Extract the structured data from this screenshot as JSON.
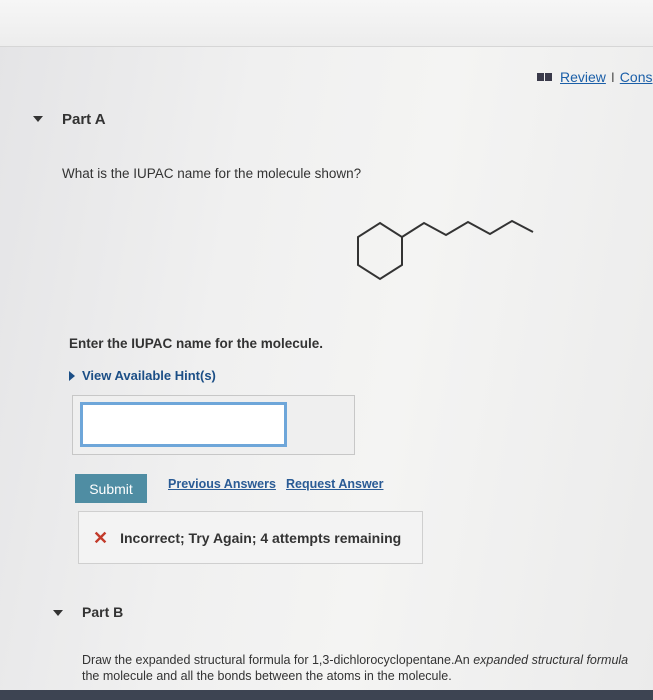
{
  "header": {
    "review_label": "Review",
    "separator": "I",
    "constants_label": "Cons"
  },
  "part_a": {
    "title": "Part A",
    "question": "What is the IUPAC name for the molecule shown?",
    "prompt": "Enter the IUPAC name for the molecule.",
    "hints_label": "View Available Hint(s)",
    "answer_value": "",
    "submit_label": "Submit",
    "previous_answers_label": "Previous Answers",
    "request_answer_label": "Request Answer",
    "feedback": "Incorrect; Try Again; 4 attempts remaining"
  },
  "part_b": {
    "title": "Part B",
    "question_line1_plain": "Draw the expanded structural formula for 1,3-dichlorocyclopentane.An ",
    "question_line1_italic": "expanded structural formula",
    "question_line2": "the molecule and all the bonds between the atoms in the molecule."
  },
  "icons": {
    "review": "book-icon",
    "collapse": "triangle-down-icon",
    "hint": "triangle-right-icon",
    "incorrect": "x-icon"
  },
  "colors": {
    "link": "#1b5fa8",
    "submit": "#4f8da3",
    "error": "#c23a2a",
    "input_focus": "#6ea6d9"
  }
}
